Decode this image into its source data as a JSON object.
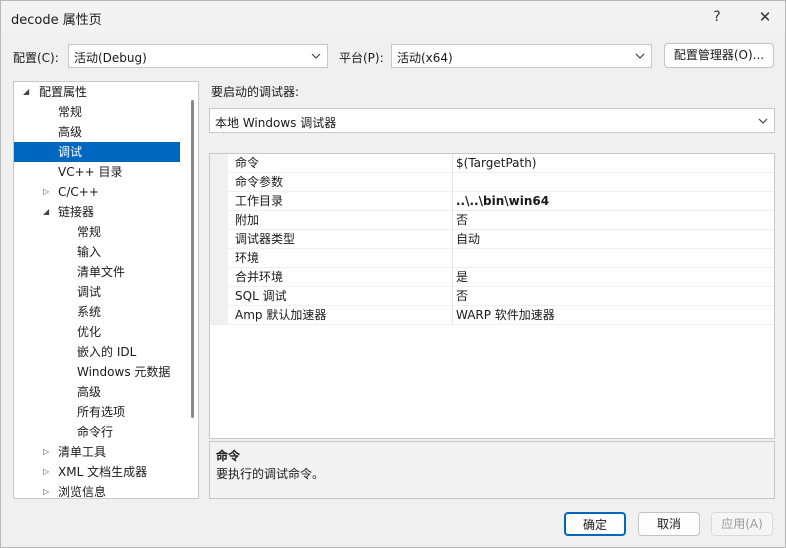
{
  "window": {
    "title": "decode 属性页",
    "help_glyph": "?",
    "close_glyph": "✕"
  },
  "config_bar": {
    "config_label": "配置(C):",
    "config_value": "活动(Debug)",
    "platform_label": "平台(P):",
    "platform_value": "活动(x64)",
    "manager_button": "配置管理器(O)..."
  },
  "tree": {
    "items": [
      {
        "label": "配置属性",
        "expander": "◢"
      },
      {
        "label": "常规",
        "expander": ""
      },
      {
        "label": "高级",
        "expander": ""
      },
      {
        "label": "调试",
        "expander": ""
      },
      {
        "label": "VC++ 目录",
        "expander": ""
      },
      {
        "label": "C/C++",
        "expander": "▷"
      },
      {
        "label": "链接器",
        "expander": "◢"
      },
      {
        "label": "常规",
        "expander": ""
      },
      {
        "label": "输入",
        "expander": ""
      },
      {
        "label": "清单文件",
        "expander": ""
      },
      {
        "label": "调试",
        "expander": ""
      },
      {
        "label": "系统",
        "expander": ""
      },
      {
        "label": "优化",
        "expander": ""
      },
      {
        "label": "嵌入的 IDL",
        "expander": ""
      },
      {
        "label": "Windows 元数据",
        "expander": ""
      },
      {
        "label": "高级",
        "expander": ""
      },
      {
        "label": "所有选项",
        "expander": ""
      },
      {
        "label": "命令行",
        "expander": ""
      },
      {
        "label": "清单工具",
        "expander": "▷"
      },
      {
        "label": "XML 文档生成器",
        "expander": "▷"
      },
      {
        "label": "浏览信息",
        "expander": "▷"
      }
    ]
  },
  "debugger": {
    "label": "要启动的调试器:",
    "value": "本地 Windows 调试器"
  },
  "properties": [
    {
      "name": "命令",
      "value": "$(TargetPath)"
    },
    {
      "name": "命令参数",
      "value": ""
    },
    {
      "name": "工作目录",
      "value": "..\\..\\bin\\win64"
    },
    {
      "name": "附加",
      "value": "否"
    },
    {
      "name": "调试器类型",
      "value": "自动"
    },
    {
      "name": "环境",
      "value": ""
    },
    {
      "name": "合并环境",
      "value": "是"
    },
    {
      "name": "SQL 调试",
      "value": "否"
    },
    {
      "name": "Amp 默认加速器",
      "value": "WARP 软件加速器"
    }
  ],
  "description": {
    "title": "命令",
    "text": "要执行的调试命令。"
  },
  "footer": {
    "ok": "确定",
    "cancel": "取消",
    "apply": "应用(A)"
  }
}
